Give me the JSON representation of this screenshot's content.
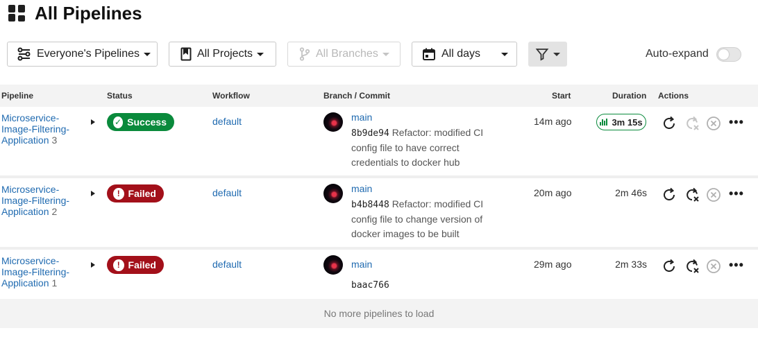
{
  "header": {
    "title": "All Pipelines",
    "icon": "dashboard-grid-icon"
  },
  "filters": {
    "owner": "Everyone's Pipelines",
    "project": "All Projects",
    "branch": "All Branches",
    "days": "All days",
    "auto_expand_label": "Auto-expand",
    "auto_expand_on": false
  },
  "table": {
    "headers": [
      "Pipeline",
      "Status",
      "Workflow",
      "Branch / Commit",
      "Start",
      "Duration",
      "Actions"
    ],
    "rows": [
      {
        "pipeline": "Microservice-Image-Filtering-Application",
        "number": "3",
        "status": "Success",
        "workflow": "default",
        "branch": "main",
        "sha": "8b9de94",
        "message": "Refactor: modified CI config file to have correct credentials to docker hub",
        "start": "14m ago",
        "duration": "3m 15s"
      },
      {
        "pipeline": "Microservice-Image-Filtering-Application",
        "number": "2",
        "status": "Failed",
        "workflow": "default",
        "branch": "main",
        "sha": "b4b8448",
        "message": "Refactor: modified CI config file to change version of docker images to be built",
        "start": "20m ago",
        "duration": "2m 46s"
      },
      {
        "pipeline": "Microservice-Image-Filtering-Application",
        "number": "1",
        "status": "Failed",
        "workflow": "default",
        "branch": "main",
        "sha": "baac766",
        "message": "",
        "start": "29m ago",
        "duration": "2m 33s"
      }
    ]
  },
  "footer": {
    "text": "No more pipelines to load"
  },
  "colors": {
    "success": "#0a8a3c",
    "failed": "#a3101a",
    "link": "#1f6ab0"
  }
}
